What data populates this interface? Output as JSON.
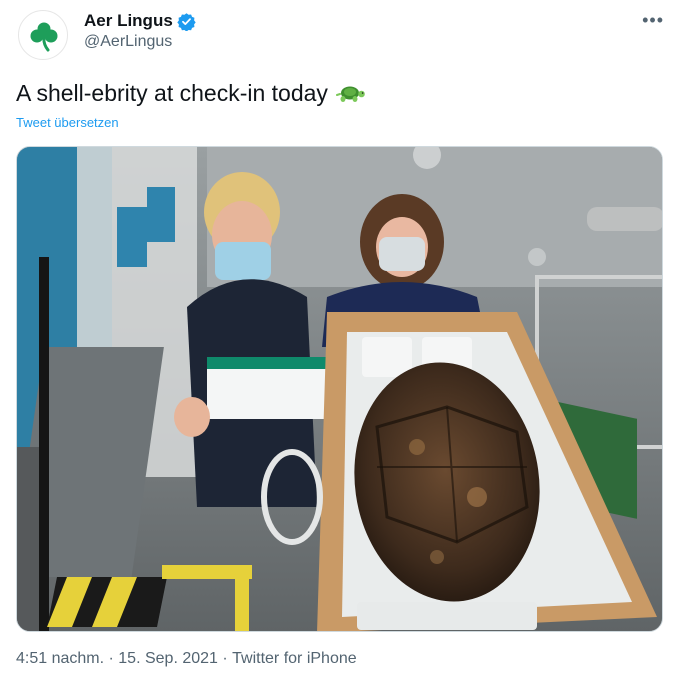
{
  "author": {
    "name": "Aer Lingus",
    "handle": "@AerLingus",
    "avatar_icon": "shamrock-icon",
    "verified_icon": "verified-badge-icon"
  },
  "menu_icon": "more-options-icon",
  "tweet": {
    "text": "A shell-ebrity at check-in today",
    "emoji_icon": "turtle-emoji-icon",
    "translate_label": "Tweet übersetzen"
  },
  "media": {
    "icon": "photo-icon"
  },
  "footer": {
    "time": "4:51 nachm.",
    "separator": " · ",
    "date": "15. Sep. 2021",
    "source": "Twitter for iPhone"
  },
  "colors": {
    "brand_green": "#1e9e5a",
    "link_blue": "#1d9bf0",
    "verified_blue": "#1d9bf0",
    "muted_gray": "#536471"
  }
}
